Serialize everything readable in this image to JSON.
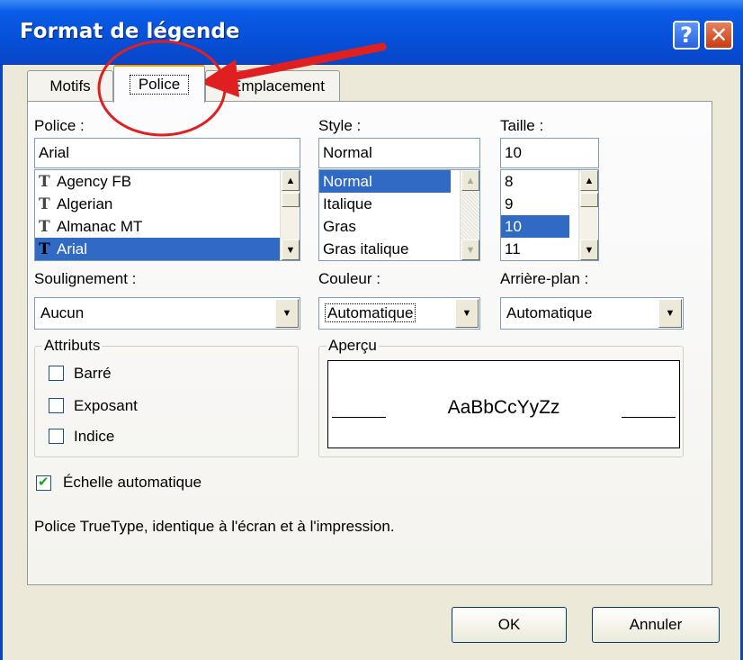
{
  "window": {
    "title": "Format de légende",
    "help_label": "?",
    "close_label": "✕"
  },
  "tabs": [
    {
      "label": "Motifs"
    },
    {
      "label": "Police"
    },
    {
      "label": "Emplacement"
    }
  ],
  "font": {
    "label": "Police :",
    "value": "Arial",
    "items": [
      "Agency FB",
      "Algerian",
      "Almanac MT",
      "Arial"
    ],
    "selected": "Arial",
    "icon": "truetype-icon",
    "icon_glyph": "T"
  },
  "style": {
    "label": "Style :",
    "value": "Normal",
    "items": [
      "Normal",
      "Italique",
      "Gras",
      "Gras italique"
    ],
    "selected": "Normal"
  },
  "size": {
    "label": "Taille :",
    "value": "10",
    "items": [
      "8",
      "9",
      "10",
      "11"
    ],
    "selected": "10"
  },
  "underline": {
    "label": "Soulignement :",
    "value": "Aucun"
  },
  "color": {
    "label": "Couleur :",
    "value": "Automatique"
  },
  "background": {
    "label": "Arrière-plan :",
    "value": "Automatique"
  },
  "attributes": {
    "title": "Attributs",
    "items": [
      {
        "label": "Barré",
        "checked": false
      },
      {
        "label": "Exposant",
        "checked": false
      },
      {
        "label": "Indice",
        "checked": false
      }
    ]
  },
  "preview": {
    "title": "Aperçu",
    "text": "AaBbCcYyZz"
  },
  "autoscale": {
    "label": "Échelle automatique",
    "checked": true
  },
  "info": "Police TrueType, identique à l'écran et à l'impression.",
  "buttons": {
    "ok": "OK",
    "cancel": "Annuler"
  },
  "annotation_color": "#e02020"
}
